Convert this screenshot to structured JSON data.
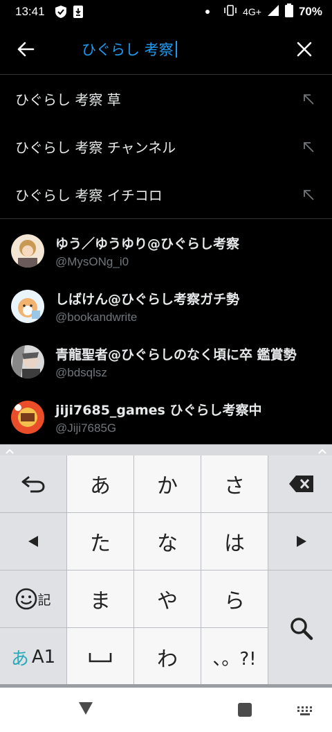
{
  "status_bar": {
    "time": "13:41",
    "network": "4G+",
    "battery": "70%"
  },
  "search": {
    "query": "ひぐらし 考察",
    "back_icon": "arrow-left-icon",
    "clear_icon": "close-icon",
    "accent_color": "#1d9bf0"
  },
  "suggestions": [
    {
      "label": "ひぐらし 考察 草"
    },
    {
      "label": "ひぐらし 考察 チャンネル"
    },
    {
      "label": "ひぐらし 考察 イチコロ"
    }
  ],
  "users": [
    {
      "name": "ゆう／ゆうゆり@ひぐらし考察",
      "handle": "@MysONg_i0"
    },
    {
      "name": "しばけん@ひぐらし考察ガチ勢",
      "handle": "@bookandwrite"
    },
    {
      "name": "青龍聖者@ひぐらしのなく頃に卒 鑑賞勢",
      "handle": "@bdsqlsz"
    },
    {
      "name": "jiji7685_games ひぐらし考察中",
      "handle": "@Jiji7685G"
    }
  ],
  "keyboard": {
    "keys": {
      "a": "あ",
      "ka": "か",
      "sa": "さ",
      "ta": "た",
      "na": "な",
      "ha": "は",
      "ma": "ま",
      "ya": "や",
      "ra": "ら",
      "wa": "わ",
      "punct": "、。?!",
      "kigo": "記",
      "mode_a": "あ",
      "mode_en": "A1"
    }
  }
}
